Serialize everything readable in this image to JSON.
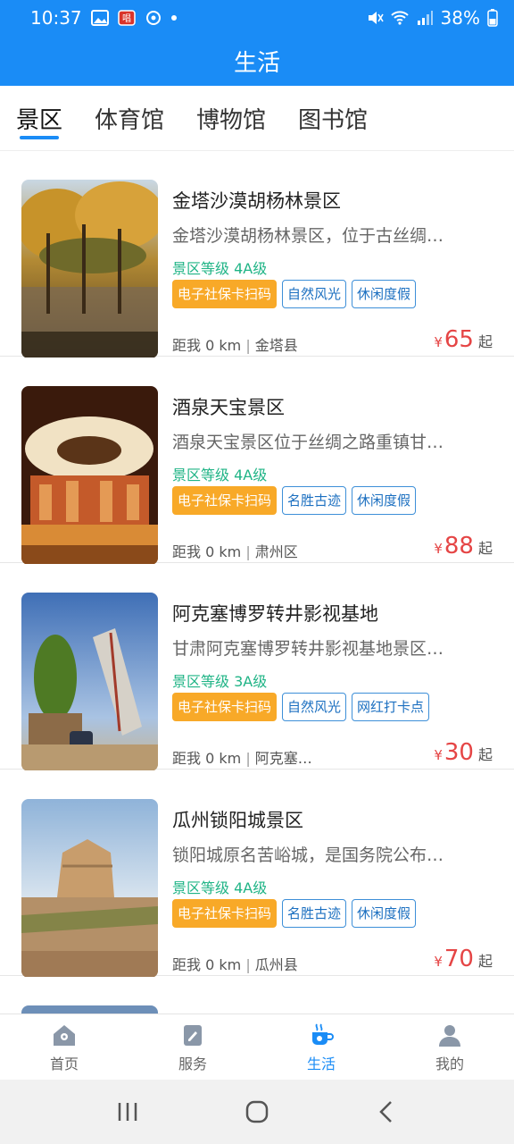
{
  "status": {
    "time": "10:37",
    "battery": "38%"
  },
  "app_title": "生活",
  "tabs": [
    {
      "label": "景区"
    },
    {
      "label": "体育馆"
    },
    {
      "label": "博物馆"
    },
    {
      "label": "图书馆"
    }
  ],
  "cards": [
    {
      "title": "金塔沙漠胡杨林景区",
      "desc": "金塔沙漠胡杨林景区，位于古丝绸…",
      "level": "景区等级 4A级",
      "tags": [
        "电子社保卡扫码",
        "自然风光",
        "休闲度假"
      ],
      "distance": "距我 0 km",
      "area": "金塔县",
      "price": "65"
    },
    {
      "title": "酒泉天宝景区",
      "desc": "酒泉天宝景区位于丝绸之路重镇甘…",
      "level": "景区等级 4A级",
      "tags": [
        "电子社保卡扫码",
        "名胜古迹",
        "休闲度假"
      ],
      "distance": "距我 0 km",
      "area": "肃州区",
      "price": "88"
    },
    {
      "title": "阿克塞博罗转井影视基地",
      "desc": "甘肃阿克塞博罗转井影视基地景区…",
      "level": "景区等级 3A级",
      "tags": [
        "电子社保卡扫码",
        "自然风光",
        "网红打卡点"
      ],
      "distance": "距我 0 km",
      "area": "阿克塞…",
      "price": "30"
    },
    {
      "title": "瓜州锁阳城景区",
      "desc": "锁阳城原名苦峪城，是国务院公布…",
      "level": "景区等级 4A级",
      "tags": [
        "电子社保卡扫码",
        "名胜古迹",
        "休闲度假"
      ],
      "distance": "距我 0 km",
      "area": "瓜州县",
      "price": "70"
    }
  ],
  "price_prefix": "¥",
  "price_suffix": "起",
  "separator": "|",
  "bottom_nav": [
    {
      "label": "首页",
      "icon": "home-icon"
    },
    {
      "label": "服务",
      "icon": "clipboard-icon"
    },
    {
      "label": "生活",
      "icon": "coffee-cup-icon"
    },
    {
      "label": "我的",
      "icon": "user-icon"
    }
  ],
  "colors": {
    "primary": "#1a8cf6",
    "price": "#e54545",
    "level": "#20b486",
    "tag_orange": "#f8a928"
  }
}
